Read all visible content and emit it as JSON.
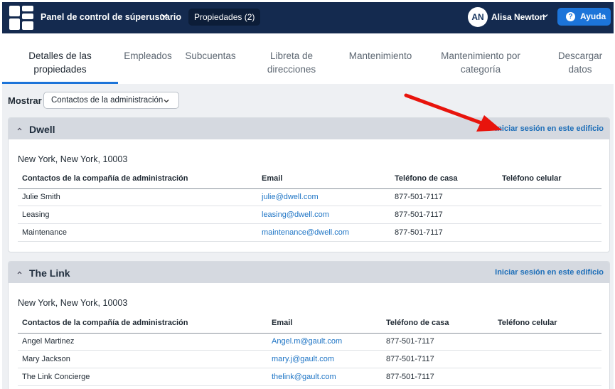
{
  "topbar": {
    "title": "Panel de control de súperusuario",
    "properties_badge": "Propiedades (2)",
    "user_initials": "AN",
    "user_name": "Alisa Newton",
    "help_label": "Ayuda",
    "bg_color": "#142a4f",
    "accent_color": "#1c74d9"
  },
  "tabs": [
    {
      "label": "Detalles de las propiedades",
      "active": true
    },
    {
      "label": "Empleados"
    },
    {
      "label": "Subcuentas"
    },
    {
      "label": "Libreta de direcciones"
    },
    {
      "label": "Mantenimiento"
    },
    {
      "label": "Mantenimiento por categoría"
    },
    {
      "label": "Descargar datos"
    }
  ],
  "filter": {
    "label": "Mostrar",
    "selected": "Contactos de la administración"
  },
  "properties": [
    {
      "name": "Dwell",
      "login_link": "Iniciar sesión en este edificio",
      "address": "New York, New York, 10003",
      "columns": [
        "Contactos de la compañía de administración",
        "Email",
        "Teléfono de casa",
        "Teléfono celular"
      ],
      "rows": [
        {
          "contact": "Julie Smith",
          "email": "julie@dwell.com",
          "home_phone": "877-501-7117",
          "cell_phone": ""
        },
        {
          "contact": "Leasing",
          "email": "leasing@dwell.com",
          "home_phone": "877-501-7117",
          "cell_phone": ""
        },
        {
          "contact": "Maintenance",
          "email": "maintenance@dwell.com",
          "home_phone": "877-501-7117",
          "cell_phone": ""
        }
      ]
    },
    {
      "name": "The Link",
      "login_link": "Iniciar sesión en este edificio",
      "address": "New York, New York, 10003",
      "columns": [
        "Contactos de la compañía de administración",
        "Email",
        "Teléfono de casa",
        "Teléfono celular"
      ],
      "rows": [
        {
          "contact": "Angel Martinez",
          "email": "Angel.m@gault.com",
          "home_phone": "877-501-7117",
          "cell_phone": ""
        },
        {
          "contact": "Mary Jackson",
          "email": "mary.j@gault.com",
          "home_phone": "877-501-7117",
          "cell_phone": ""
        },
        {
          "contact": "The Link Concierge",
          "email": "thelink@gault.com",
          "home_phone": "877-501-7117",
          "cell_phone": ""
        }
      ]
    }
  ],
  "annotation": {
    "arrow_color": "#e8140c"
  }
}
